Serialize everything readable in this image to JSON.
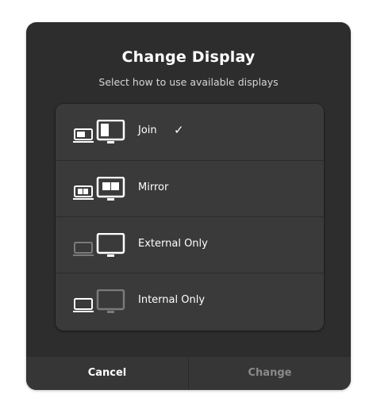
{
  "dialog": {
    "title": "Change Display",
    "subtitle": "Select how to use available displays"
  },
  "options": [
    {
      "label": "Join",
      "icon": "display-join-icon",
      "selected": true,
      "check": "✓"
    },
    {
      "label": "Mirror",
      "icon": "display-mirror-icon",
      "selected": false
    },
    {
      "label": "External Only",
      "icon": "display-external-only-icon",
      "selected": false
    },
    {
      "label": "Internal Only",
      "icon": "display-internal-only-icon",
      "selected": false
    }
  ],
  "buttons": {
    "cancel": "Cancel",
    "change": "Change"
  },
  "colors": {
    "dialog_bg": "#2d2d2d",
    "list_bg": "#3a3a3a",
    "text": "#ffffff",
    "dimmed": "#8a8a8a"
  }
}
